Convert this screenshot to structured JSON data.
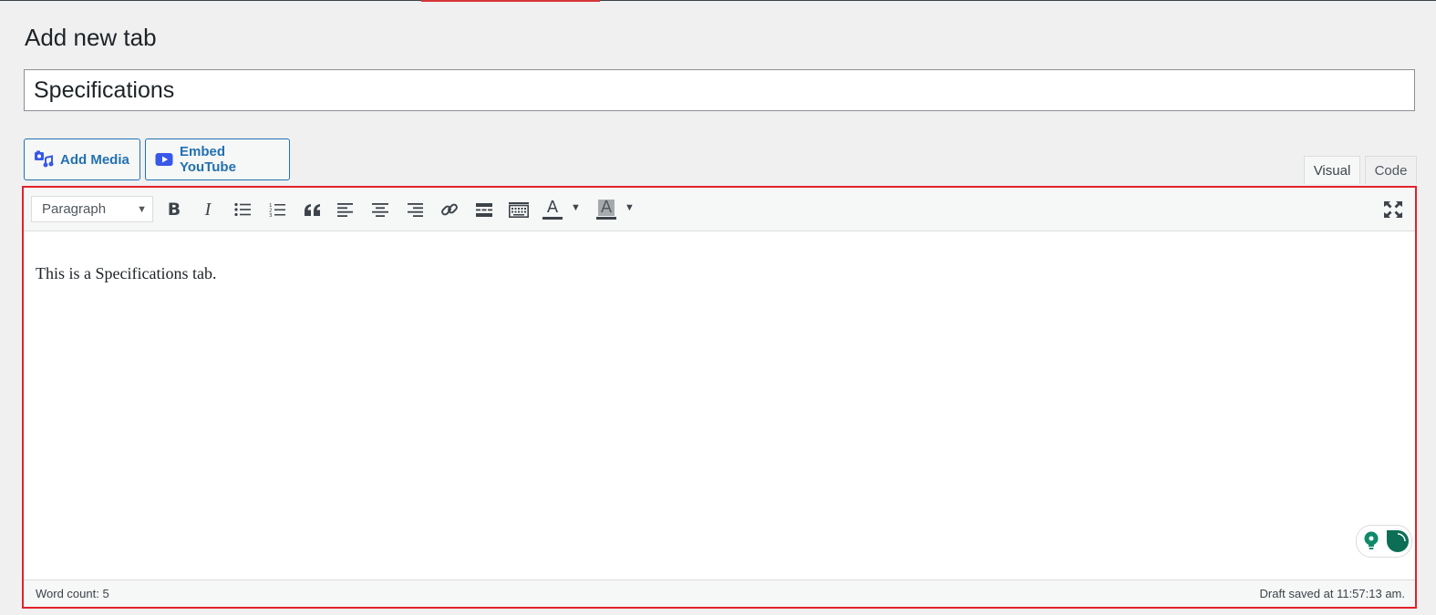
{
  "page": {
    "title": "Add new tab"
  },
  "title_field": {
    "value": "Specifications"
  },
  "media_buttons": {
    "add_media": "Add Media",
    "embed_youtube": "Embed YouTube"
  },
  "editor_tabs": {
    "visual": "Visual",
    "code": "Code",
    "active": "Visual"
  },
  "toolbar": {
    "format_select": "Paragraph",
    "icons": [
      "bold-icon",
      "italic-icon",
      "bulleted-list-icon",
      "numbered-list-icon",
      "blockquote-icon",
      "align-left-icon",
      "align-center-icon",
      "align-right-icon",
      "link-icon",
      "read-more-icon",
      "toolbar-toggle-icon",
      "text-color-icon",
      "background-color-icon",
      "fullscreen-icon"
    ],
    "bold": "B",
    "italic": "I",
    "text_color": "A",
    "bg_color": "A"
  },
  "editor": {
    "content": "This is a Specifications tab."
  },
  "status": {
    "word_count": "Word count: 5",
    "draft_saved": "Draft saved at 11:57:13 am."
  },
  "colors": {
    "accent": "#2271b1",
    "highlight_border": "#e2222b",
    "youtube_icon": "#3858e9",
    "assistant": "#0e8a6a"
  }
}
